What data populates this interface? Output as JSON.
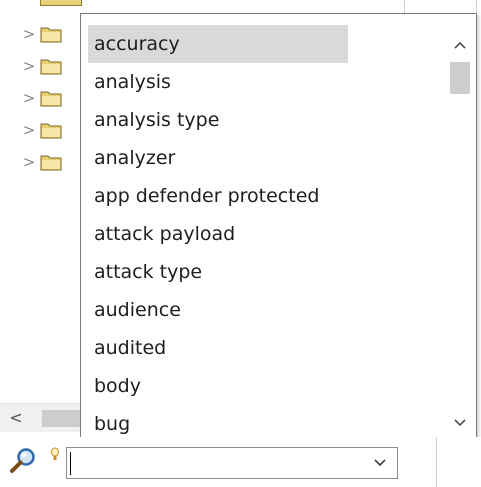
{
  "tree": {
    "rows": [
      {
        "chevron": ">",
        "icon": "folder-icon"
      },
      {
        "chevron": ">",
        "icon": "folder-icon"
      },
      {
        "chevron": ">",
        "icon": "folder-icon"
      },
      {
        "chevron": ">",
        "icon": "folder-icon"
      },
      {
        "chevron": ">",
        "icon": "folder-icon"
      }
    ],
    "hscroll_left": "<"
  },
  "dropdown": {
    "items": [
      "accuracy",
      "analysis",
      "analysis type",
      "analyzer",
      "app defender protected",
      "attack payload",
      "attack type",
      "audience",
      "audited",
      "body",
      "bug"
    ],
    "selected_index": 0,
    "scroll_up": "^",
    "scroll_down": "v"
  },
  "search": {
    "icon": "magnifier-icon",
    "hint_icon": "lightbulb-icon",
    "value": "",
    "arrow": "v"
  },
  "colors": {
    "selection": "#d9d9d9",
    "folder": "#e8cf6e",
    "border": "#7a7a7a",
    "scroll_thumb": "#cdcdcd"
  }
}
